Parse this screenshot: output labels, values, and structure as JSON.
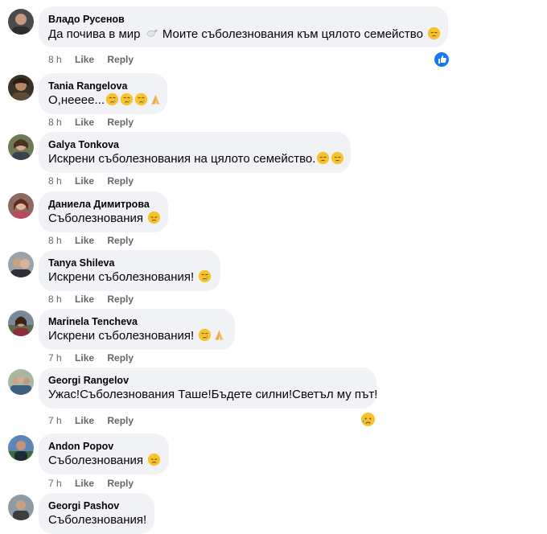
{
  "comments": [
    {
      "name": "Владо Русенов",
      "text": "Да почива в мир",
      "text2": "Моите съболезнования към цялото семейство",
      "time": "8 h",
      "like": "Like",
      "reply": "Reply"
    },
    {
      "name": "Tania Rangelova",
      "text": "О,нееее...",
      "time": "8 h",
      "like": "Like",
      "reply": "Reply"
    },
    {
      "name": "Galya Tonkova",
      "text": "Искрени съболезнования на цялото семейство.",
      "time": "8 h",
      "like": "Like",
      "reply": "Reply"
    },
    {
      "name": "Даниела Димитрова",
      "text": "Съболезнования",
      "time": "8 h",
      "like": "Like",
      "reply": "Reply"
    },
    {
      "name": "Tanya Shileva",
      "text": "Искрени съболезнования!",
      "time": "8 h",
      "like": "Like",
      "reply": "Reply"
    },
    {
      "name": "Marinela Tencheva",
      "text": "Искрени съболезнования!",
      "time": "7 h",
      "like": "Like",
      "reply": "Reply"
    },
    {
      "name": "Georgi Rangelov",
      "text": "Ужас!Съболезнования Таше!Бъдете силни!Светъл му път!",
      "time": "7 h",
      "like": "Like",
      "reply": "Reply"
    },
    {
      "name": "Andon Popov",
      "text": "Съболезнования",
      "time": "7 h",
      "like": "Like",
      "reply": "Reply"
    },
    {
      "name": "Georgi Pashov",
      "text": "Съболезнования!"
    }
  ],
  "colors": {
    "bubble": "#f0f2f5",
    "meta": "#65676b",
    "like_blue": "#1877f2",
    "emoji": "#f7c22a"
  },
  "icons": [
    "dove-icon",
    "pensive-face-icon",
    "crying-face-icon",
    "folded-hands-icon",
    "disappointed-face-icon",
    "sad-sweat-face-icon",
    "like-reaction-icon"
  ]
}
